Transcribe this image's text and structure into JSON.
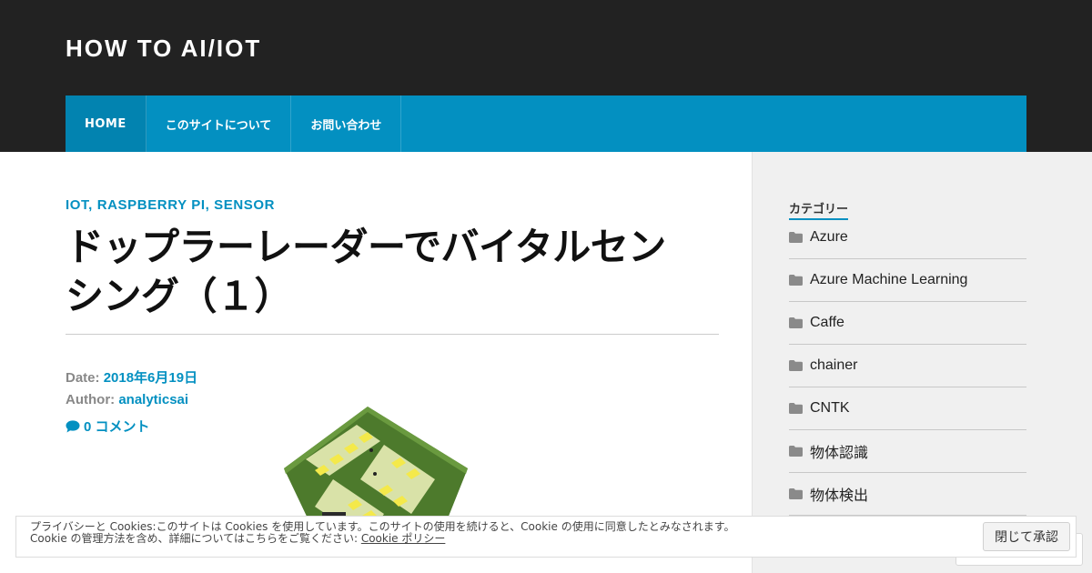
{
  "header": {
    "site_title": "HOW TO AI/IOT",
    "nav": [
      "HOME",
      "このサイトについて",
      "お問い合わせ"
    ]
  },
  "post": {
    "categories": [
      "IOT",
      "RASPBERRY PI",
      "SENSOR"
    ],
    "category_sep": ", ",
    "title_line1": "ドップラーレーダーでバイタルセン",
    "title_line2": "シング（１）",
    "date_label": "Date:",
    "date_value": "2018年6月19日",
    "author_label": "Author:",
    "author_value": "analyticsai",
    "comments": "0 コメント"
  },
  "sidebar": {
    "widget_title": "カテゴリー",
    "categories": [
      "Azure",
      "Azure Machine Learning",
      "Caffe",
      "chainer",
      "CNTK",
      "物体認識",
      "物体検出"
    ]
  },
  "cookie": {
    "line1": "プライバシーと Cookies:このサイトは Cookies を使用しています。このサイトの使用を続けると、Cookie の使用に同意したとみなされます。",
    "line2_prefix": "Cookie の管理方法を含め、詳細についてはこちらをご覧ください: ",
    "policy_link": "Cookie ポリシー",
    "accept_button": "閉じて承認"
  },
  "colors": {
    "header_bg": "#222222",
    "nav_bg": "#0390c1",
    "accent": "#0390c1",
    "sidebar_bg": "#f0f0f0",
    "board_green": "#4d7a2c"
  },
  "icons": {
    "comment": "comment-bubble-icon",
    "folder": "folder-icon"
  }
}
